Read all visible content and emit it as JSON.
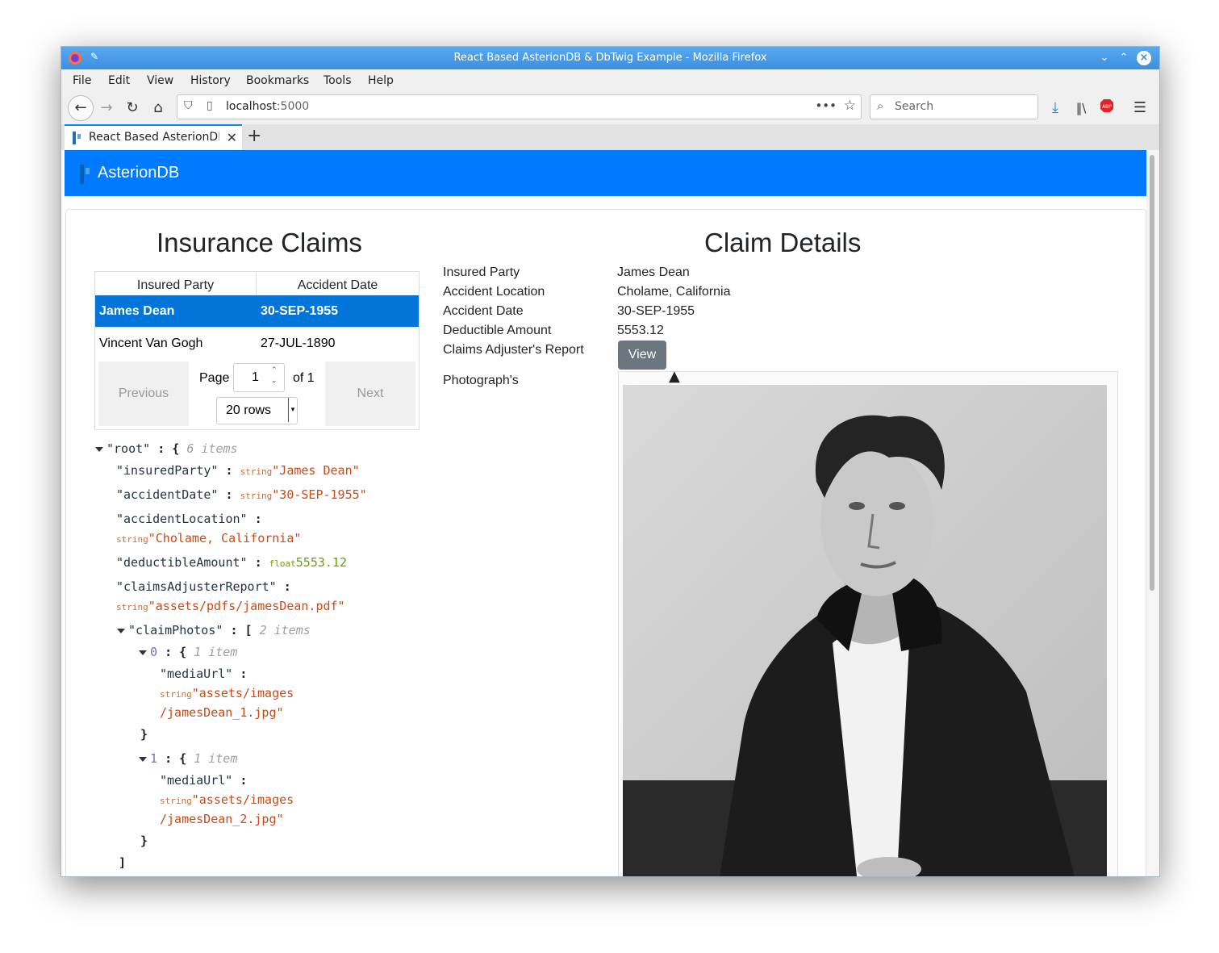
{
  "window": {
    "title": "React Based AsterionDB & DbTwig Example - Mozilla Firefox"
  },
  "menu": [
    "File",
    "Edit",
    "View",
    "History",
    "Bookmarks",
    "Tools",
    "Help"
  ],
  "urlbar": {
    "host": "localhost",
    "port": ":5000"
  },
  "search": {
    "placeholder": "Search"
  },
  "tab": {
    "label": "React Based AsterionDB"
  },
  "app": {
    "brand": "AsterionDB",
    "accent": "#007bff"
  },
  "claims": {
    "heading": "Insurance Claims",
    "columns": [
      "Insured Party",
      "Accident Date"
    ],
    "rows": [
      {
        "party": "James Dean",
        "date": "30-SEP-1955"
      },
      {
        "party": "Vincent Van Gogh",
        "date": "27-JUL-1890"
      }
    ],
    "pager": {
      "previous": "Previous",
      "next": "Next",
      "page_label": "Page",
      "page": "1",
      "of": "of 1",
      "rows": "20 rows"
    }
  },
  "json_tree": {
    "root_key": "\"root\"",
    "root_meta": "6 items",
    "insuredParty_key": "\"insuredParty\"",
    "insuredParty_val": "\"James Dean\"",
    "accidentDate_key": "\"accidentDate\"",
    "accidentDate_val": "\"30-SEP-1955\"",
    "accidentLocation_key": "\"accidentLocation\"",
    "accidentLocation_val": "\"Cholame, California\"",
    "deductibleAmount_key": "\"deductibleAmount\"",
    "deductibleAmount_val": "5553.12",
    "claimsAdjusterReport_key": "\"claimsAdjusterReport\"",
    "claimsAdjusterReport_val": "\"assets/pdfs/jamesDean.pdf\"",
    "claimPhotos_key": "\"claimPhotos\"",
    "claimPhotos_meta": "2 items",
    "item_meta": "1 item",
    "mediaUrl_key": "\"mediaUrl\"",
    "photo0_line1": "\"assets/images",
    "photo0_line2": "/jamesDean_1.jpg\"",
    "photo1_line1": "\"assets/images",
    "photo1_line2": "/jamesDean_2.jpg\"",
    "type_string": "string",
    "type_float": "float"
  },
  "details": {
    "heading": "Claim Details",
    "labels": [
      "Insured Party",
      "Accident Location",
      "Accident Date",
      "Deductible Amount",
      "Claims Adjuster's Report",
      "Photograph's"
    ],
    "values": [
      "James Dean",
      "Cholame, California",
      "30-SEP-1955",
      "5553.12"
    ],
    "view_button": "View"
  }
}
